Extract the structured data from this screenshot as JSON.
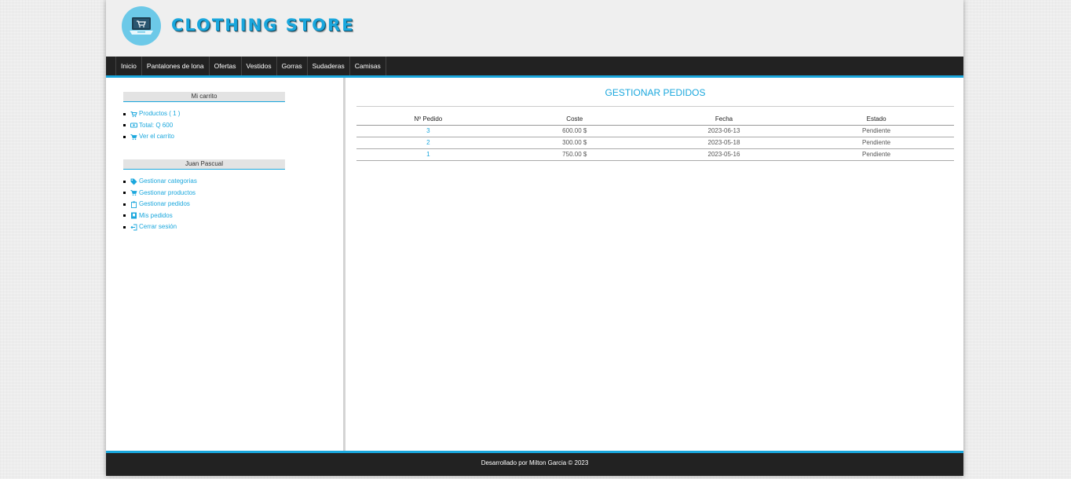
{
  "header": {
    "title": "CLOTHING STORE"
  },
  "nav": {
    "items": [
      "Inicio",
      "Pantalones de lona",
      "Ofertas",
      "Vestidos",
      "Gorras",
      "Sudaderas",
      "Camisas"
    ]
  },
  "cart": {
    "title": "Mi carrito",
    "items": [
      {
        "icon": "cart-icon",
        "label": "Productos ( 1 )"
      },
      {
        "icon": "money-icon",
        "label": "Total: Q 600"
      },
      {
        "icon": "cart-icon",
        "label": "Ver el carrito"
      }
    ]
  },
  "user": {
    "title": "Juan Pascual",
    "items": [
      {
        "icon": "tag-icon",
        "label": "Gestionar categorias"
      },
      {
        "icon": "cart-icon",
        "label": "Gestionar productos"
      },
      {
        "icon": "clipboard-icon",
        "label": "Gestionar pedidos"
      },
      {
        "icon": "bookmark-icon",
        "label": "Mis pedidos"
      },
      {
        "icon": "logout-icon",
        "label": "Cerrar sesión"
      }
    ]
  },
  "main": {
    "title": "GESTIONAR PEDIDOS",
    "table": {
      "headers": [
        "Nº Pedido",
        "Coste",
        "Fecha",
        "Estado"
      ],
      "rows": [
        [
          "3",
          "600.00 $",
          "2023-06-13",
          "Pendiente"
        ],
        [
          "2",
          "300.00 $",
          "2023-05-18",
          "Pendiente"
        ],
        [
          "1",
          "750.00 $",
          "2023-05-16",
          "Pendiente"
        ]
      ]
    }
  },
  "footer": {
    "text": "Desarrollado por Milton Garcia © 2023"
  },
  "colors": {
    "accent": "#1aa7dd",
    "nav_bg": "#222222",
    "logo_circle": "#6cc9e8"
  }
}
